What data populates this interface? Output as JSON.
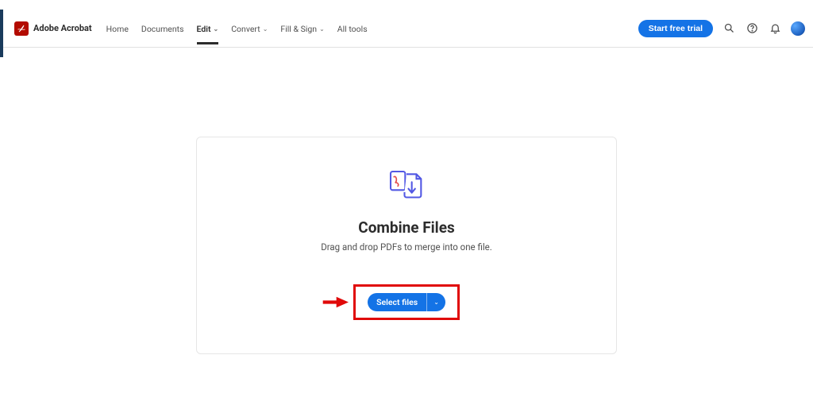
{
  "brand": {
    "name": "Adobe Acrobat"
  },
  "nav": {
    "home": "Home",
    "documents": "Documents",
    "edit": "Edit",
    "convert": "Convert",
    "fillsign": "Fill & Sign",
    "alltools": "All tools"
  },
  "header": {
    "cta": "Start free trial"
  },
  "main": {
    "title": "Combine Files",
    "subtitle": "Drag and drop PDFs to merge into one file.",
    "selectFiles": "Select files"
  }
}
